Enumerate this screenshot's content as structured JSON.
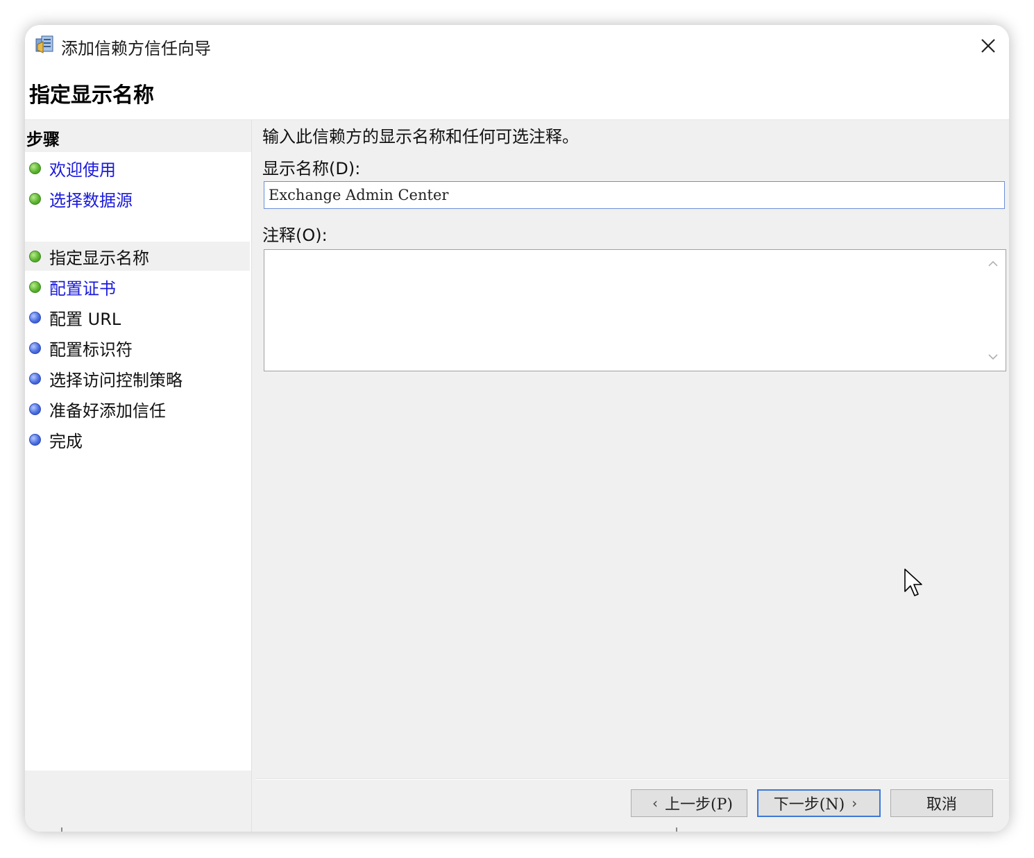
{
  "window": {
    "title": "添加信赖方信任向导",
    "icon": "server-trust-icon",
    "close_icon": "close-icon"
  },
  "header": {
    "page_title": "指定显示名称"
  },
  "steps": {
    "heading": "步骤",
    "items": [
      {
        "label": "欢迎使用",
        "status": "done",
        "link": true
      },
      {
        "label": "选择数据源",
        "status": "done",
        "link": true
      },
      {
        "label": "指定显示名称",
        "status": "current",
        "link": false
      },
      {
        "label": "配置证书",
        "status": "done",
        "link": true
      },
      {
        "label": "配置 URL",
        "status": "pending",
        "link": false
      },
      {
        "label": "配置标识符",
        "status": "pending",
        "link": false
      },
      {
        "label": "选择访问控制策略",
        "status": "pending",
        "link": false
      },
      {
        "label": "准备好添加信任",
        "status": "pending",
        "link": false
      },
      {
        "label": "完成",
        "status": "pending",
        "link": false
      }
    ]
  },
  "main": {
    "intro": "输入此信赖方的显示名称和任何可选注释。",
    "display_name_label": "显示名称(D):",
    "display_name_value": "Exchange Admin Center",
    "notes_label": "注释(O):",
    "notes_value": ""
  },
  "buttons": {
    "back": "上一步(P)",
    "next": "下一步(N)",
    "cancel": "取消"
  },
  "colors": {
    "link": "#1a1adb",
    "done_dot": "#5db530",
    "pending_dot": "#4b6fe0",
    "primary_border": "#3c78d8"
  }
}
